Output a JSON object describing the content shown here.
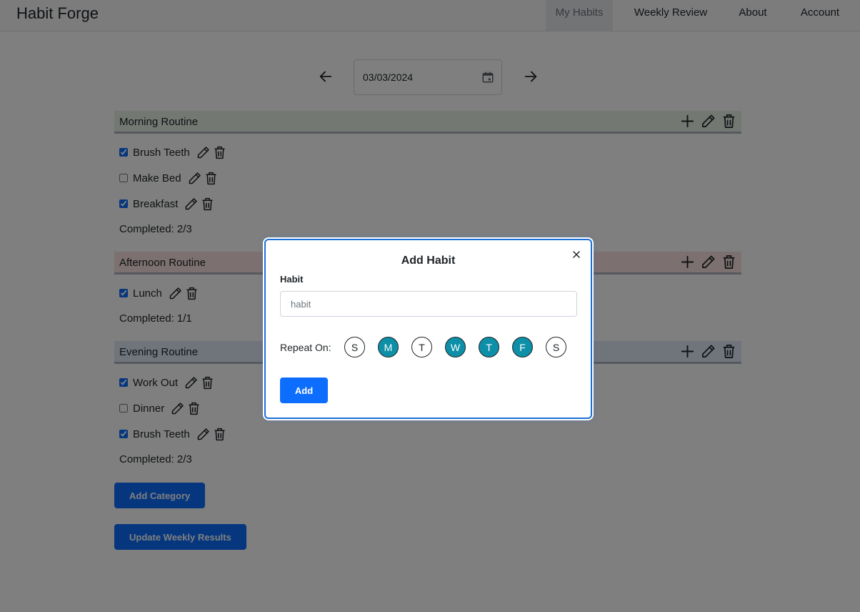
{
  "navbar": {
    "brand": "Habit Forge",
    "links": [
      {
        "label": "My Habits",
        "active": true
      },
      {
        "label": "Weekly Review",
        "active": false
      },
      {
        "label": "About",
        "active": false
      },
      {
        "label": "Account",
        "active": false
      }
    ]
  },
  "date_picker": {
    "value": "03/03/2024",
    "prev_icon": "arrow-left-icon",
    "next_icon": "arrow-right-icon",
    "calendar_icon": "calendar-icon"
  },
  "categories": [
    {
      "title": "Morning Routine",
      "color": "#e6f1e6",
      "habits": [
        {
          "name": "Brush Teeth",
          "checked": true
        },
        {
          "name": "Make Bed",
          "checked": false
        },
        {
          "name": "Breakfast",
          "checked": true
        }
      ],
      "completed": "Completed: 2/3"
    },
    {
      "title": "Afternoon Routine",
      "color": "#f8e0e0",
      "habits": [
        {
          "name": "Lunch",
          "checked": true
        }
      ],
      "completed": "Completed: 1/1"
    },
    {
      "title": "Evening Routine",
      "color": "#e0e9f7",
      "habits": [
        {
          "name": "Work Out",
          "checked": true
        },
        {
          "name": "Dinner",
          "checked": false
        },
        {
          "name": "Brush Teeth",
          "checked": true
        }
      ],
      "completed": "Completed: 2/3"
    }
  ],
  "buttons": {
    "add_category": "Add Category",
    "update_weekly": "Update Weekly Results"
  },
  "modal": {
    "title": "Add Habit",
    "field_label": "Habit",
    "input_placeholder": "habit",
    "input_value": "",
    "repeat_label": "Repeat On:",
    "days": [
      {
        "label": "S",
        "selected": false
      },
      {
        "label": "M",
        "selected": true
      },
      {
        "label": "T",
        "selected": false
      },
      {
        "label": "W",
        "selected": true
      },
      {
        "label": "T",
        "selected": true
      },
      {
        "label": "F",
        "selected": true
      },
      {
        "label": "S",
        "selected": false
      }
    ],
    "submit_label": "Add",
    "close_icon": "close-icon"
  },
  "colors": {
    "primary": "#0d6efd",
    "day_selected": "#0d8fa8"
  }
}
